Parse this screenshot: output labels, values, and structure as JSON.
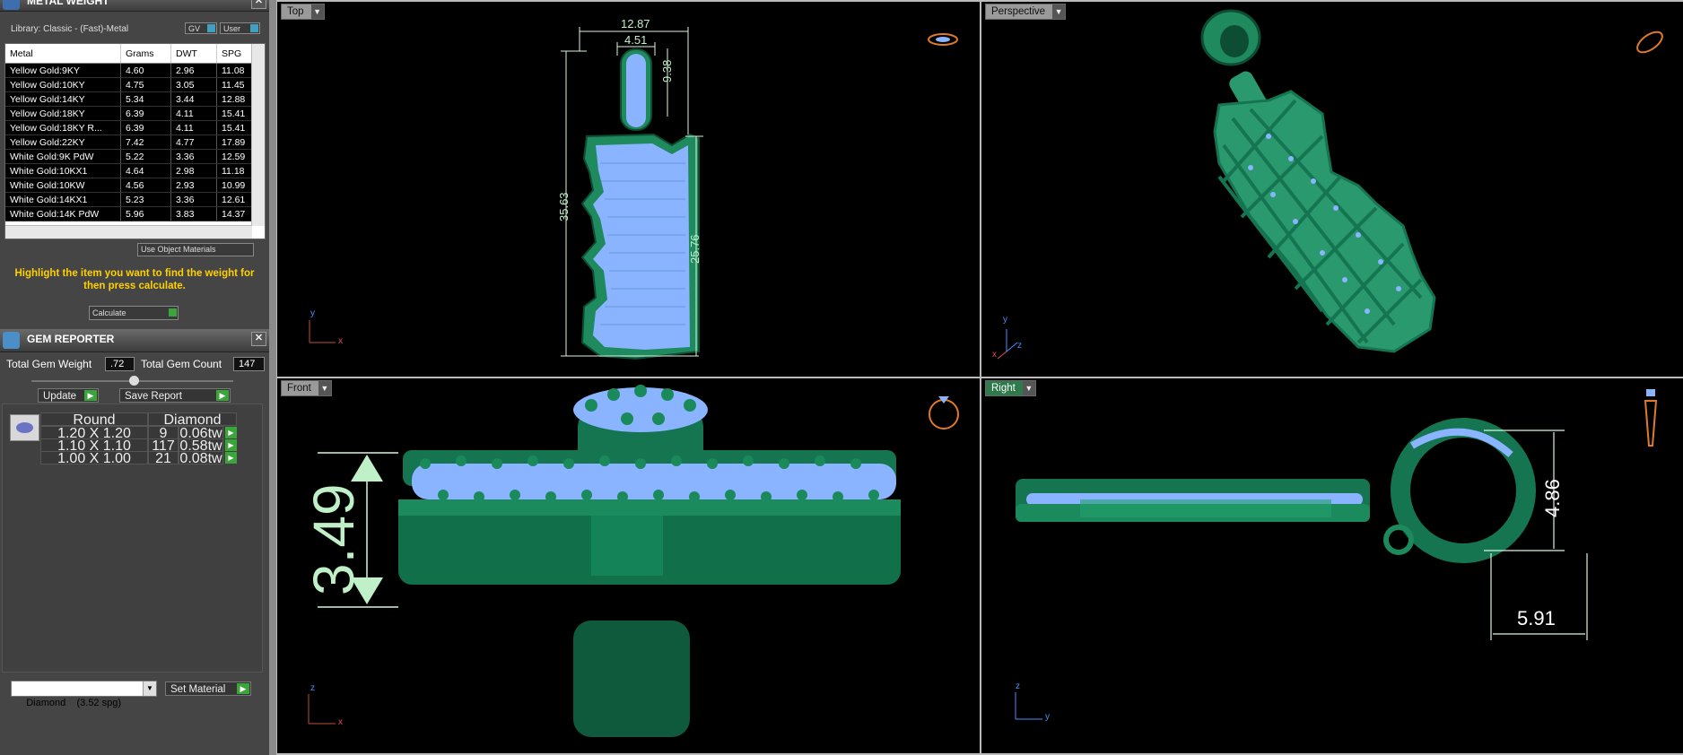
{
  "metal_weight": {
    "title": "METAL WEIGHT",
    "library": "Library: Classic - (Fast)-Metal",
    "toggles": [
      "GV",
      "User"
    ],
    "columns": [
      "Metal",
      "Grams",
      "DWT",
      "SPG"
    ],
    "rows": [
      [
        "Yellow Gold:9KY",
        "4.60",
        "2.96",
        "11.08"
      ],
      [
        "Yellow Gold:10KY",
        "4.75",
        "3.05",
        "11.45"
      ],
      [
        "Yellow Gold:14KY",
        "5.34",
        "3.44",
        "12.88"
      ],
      [
        "Yellow Gold:18KY",
        "6.39",
        "4.11",
        "15.41"
      ],
      [
        "Yellow Gold:18KY R...",
        "6.39",
        "4.11",
        "15.41"
      ],
      [
        "Yellow Gold:22KY",
        "7.42",
        "4.77",
        "17.89"
      ],
      [
        "White Gold:9K PdW",
        "5.22",
        "3.36",
        "12.59"
      ],
      [
        "White Gold:10KX1",
        "4.64",
        "2.98",
        "11.18"
      ],
      [
        "White Gold:10KW",
        "4.56",
        "2.93",
        "10.99"
      ],
      [
        "White Gold:14KX1",
        "5.23",
        "3.36",
        "12.61"
      ],
      [
        "White Gold:14K PdW",
        "5.96",
        "3.83",
        "14.37"
      ]
    ],
    "use_object_materials": "Use Object Materials",
    "hint": "Highlight the item you want to find the weight for then press calculate.",
    "calculate": "Calculate"
  },
  "gem_reporter": {
    "title": "GEM REPORTER",
    "total_weight_label": "Total Gem Weight",
    "total_weight_value": ".72",
    "total_count_label": "Total Gem Count",
    "total_count_value": "147",
    "update": "Update",
    "save_report": "Save Report",
    "col_shape": "Round",
    "col_type": "Diamond",
    "gems": [
      {
        "size": "1.20 X 1.20",
        "count": "9",
        "tw": "0.06tw"
      },
      {
        "size": "1.10 X 1.10",
        "count": "117",
        "tw": "0.58tw"
      },
      {
        "size": "1.00 X 1.00",
        "count": "21",
        "tw": "0.08tw"
      }
    ],
    "material_select": "Diamond    (3.52 spg)",
    "set_material": "Set Material"
  },
  "viewports": {
    "top": {
      "label": "Top",
      "dims": {
        "w1": "12.87",
        "w2": "4.51",
        "h1": "9.38",
        "h2": "35.63",
        "h3": "25.76"
      },
      "axes": {
        "a": "y",
        "b": "x"
      }
    },
    "perspective": {
      "label": "Perspective",
      "axes": {
        "a": "y",
        "b": "z",
        "c": "x"
      }
    },
    "front": {
      "label": "Front",
      "dims": {
        "h": "3.49"
      },
      "axes": {
        "a": "z",
        "b": "x"
      }
    },
    "right": {
      "label": "Right",
      "dims": {
        "h": "4.86",
        "w": "5.91"
      },
      "axes": {
        "a": "z",
        "b": "y"
      }
    }
  },
  "colors": {
    "metal": "#2a9a6e",
    "gem": "#8ab4ff",
    "dim": "#bff0c8",
    "accent": "#3aa53a",
    "hint": "#ffd000"
  }
}
